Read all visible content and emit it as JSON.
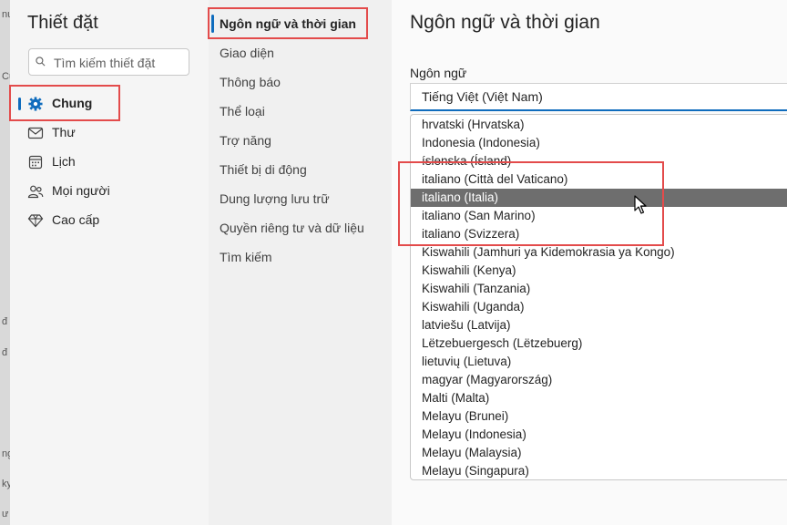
{
  "background_fragments": [
    "nư",
    "Cu",
    "đ",
    "đ",
    "ng",
    "ky",
    "ư"
  ],
  "settings": {
    "title": "Thiết đặt",
    "search_placeholder": "Tìm kiếm thiết đặt",
    "nav": [
      {
        "label": "Chung",
        "icon": "gear-icon",
        "active": true
      },
      {
        "label": "Thư",
        "icon": "mail-icon",
        "active": false
      },
      {
        "label": "Lịch",
        "icon": "calendar-icon",
        "active": false
      },
      {
        "label": "Mọi người",
        "icon": "people-icon",
        "active": false
      },
      {
        "label": "Cao cấp",
        "icon": "diamond-icon",
        "active": false
      }
    ]
  },
  "subnav": [
    "Ngôn ngữ và thời gian",
    "Giao diện",
    "Thông báo",
    "Thể loại",
    "Trợ năng",
    "Thiết bị di động",
    "Dung lượng lưu trữ",
    "Quyền riêng tư và dữ liệu",
    "Tìm kiếm"
  ],
  "panel": {
    "title": "Ngôn ngữ và thời gian",
    "language_label": "Ngôn ngữ",
    "language_value": "Tiếng Việt (Việt Nam)",
    "options": [
      "hrvatski (Hrvatska)",
      "Indonesia (Indonesia)",
      "íslenska (Ísland)",
      "italiano (Città del Vaticano)",
      "italiano (Italia)",
      "italiano (San Marino)",
      "italiano (Svizzera)",
      "Kiswahili (Jamhuri ya Kidemokrasia ya Kongo)",
      "Kiswahili (Kenya)",
      "Kiswahili (Tanzania)",
      "Kiswahili (Uganda)",
      "latviešu (Latvija)",
      "Lëtzebuergesch (Lëtzebuerg)",
      "lietuvių (Lietuva)",
      "magyar (Magyarország)",
      "Malti (Malta)",
      "Melayu (Brunei)",
      "Melayu (Indonesia)",
      "Melayu (Malaysia)",
      "Melayu (Singapura)"
    ],
    "highlighted_option": "italiano (Italia)"
  },
  "colors": {
    "accent": "#0f6cbd",
    "annotation_red": "#e34b4b",
    "selected_option_bg": "#6e6e6e"
  }
}
